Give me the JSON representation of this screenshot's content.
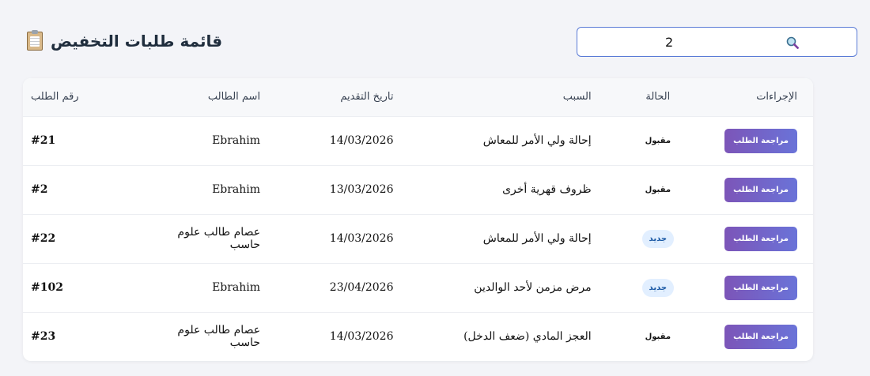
{
  "header": {
    "title": "قائمة طلبات التخفيض",
    "icon": "clipboard-icon"
  },
  "search": {
    "value": "2",
    "icon": "search-icon"
  },
  "table": {
    "columns": {
      "id": "رقم الطلب",
      "student": "اسم الطالب",
      "date": "تاريخ التقديم",
      "reason": "السبب",
      "status": "الحالة",
      "actions": "الإجراءات"
    },
    "rows": [
      {
        "id": "#21",
        "student": "Ebrahim",
        "date": "14/03/2026",
        "reason": "إحالة ولي الأمر للمعاش",
        "status": "مقبول",
        "status_type": "accepted",
        "action": "مراجعة الطلب"
      },
      {
        "id": "#2",
        "student": "Ebrahim",
        "date": "13/03/2026",
        "reason": "ظروف قهرية أخرى",
        "status": "مقبول",
        "status_type": "accepted",
        "action": "مراجعة الطلب"
      },
      {
        "id": "#22",
        "student": "عصام طالب علوم حاسب",
        "date": "14/03/2026",
        "reason": "إحالة ولي الأمر للمعاش",
        "status": "جديد",
        "status_type": "new",
        "action": "مراجعة الطلب"
      },
      {
        "id": "#102",
        "student": "Ebrahim",
        "date": "23/04/2026",
        "reason": "مرض مزمن لأحد الوالدين",
        "status": "جديد",
        "status_type": "new",
        "action": "مراجعة الطلب"
      },
      {
        "id": "#23",
        "student": "عصام طالب علوم حاسب",
        "date": "14/03/2026",
        "reason": "العجز المادي (ضعف الدخل)",
        "status": "مقبول",
        "status_type": "accepted",
        "action": "مراجعة الطلب"
      }
    ]
  },
  "colors": {
    "accent_start": "#7c55b8",
    "accent_end": "#6a73d8",
    "new_badge_bg": "#e2efff",
    "new_badge_text": "#1c5aa6",
    "search_border": "#5a7bd6"
  }
}
